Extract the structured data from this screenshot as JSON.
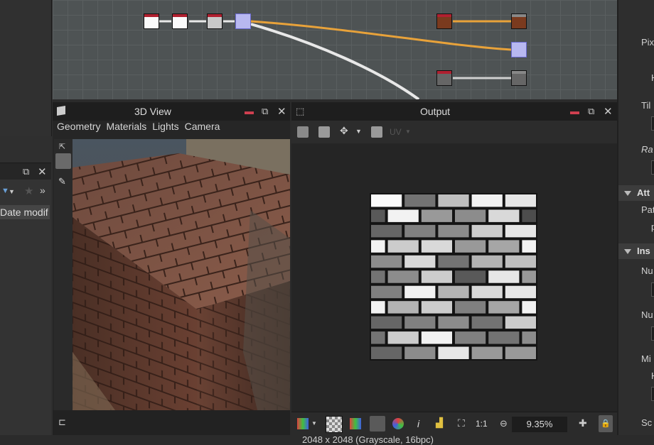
{
  "left": {
    "date_column": "Date modif",
    "star_icon": "★",
    "more": "»"
  },
  "graph": {
    "accent_orange": "#e8a23a",
    "link_white": "#e8e8e8"
  },
  "view3d": {
    "title": "3D View",
    "menu": [
      "Geometry",
      "Materials",
      "Lights",
      "Camera"
    ]
  },
  "output": {
    "title": "Output",
    "toolbar_uv": "UV",
    "info": "2048 x 2048 (Grayscale, 16bpc)",
    "zoom": "9.35%",
    "ratio_label": "1:1",
    "italic_i": "i",
    "brick_rows": [
      [
        0.98,
        0.45,
        0.75,
        0.95,
        0.9
      ],
      [
        0.35,
        0.95,
        0.6,
        0.55,
        0.85,
        0.3
      ],
      [
        0.4,
        0.5,
        0.55,
        0.8,
        0.9
      ],
      [
        0.95,
        0.8,
        0.85,
        0.6,
        0.65,
        0.95
      ],
      [
        0.55,
        0.85,
        0.45,
        0.7,
        0.75
      ],
      [
        0.45,
        0.55,
        0.8,
        0.35,
        0.9,
        0.6
      ],
      [
        0.5,
        0.95,
        0.7,
        0.85,
        0.9
      ],
      [
        0.95,
        0.7,
        0.8,
        0.5,
        0.65,
        0.95
      ],
      [
        0.4,
        0.5,
        0.55,
        0.45,
        0.8
      ],
      [
        0.45,
        0.8,
        0.95,
        0.5,
        0.45,
        0.55
      ],
      [
        0.4,
        0.55,
        0.9,
        0.6,
        0.6
      ]
    ]
  },
  "right": {
    "labels": [
      "Pix",
      "H",
      "Til",
      "Ra",
      "Pat",
      "Nu",
      "Nu",
      "Mi",
      "H",
      "Sc"
    ],
    "sections": [
      "Att",
      "Ins"
    ]
  }
}
